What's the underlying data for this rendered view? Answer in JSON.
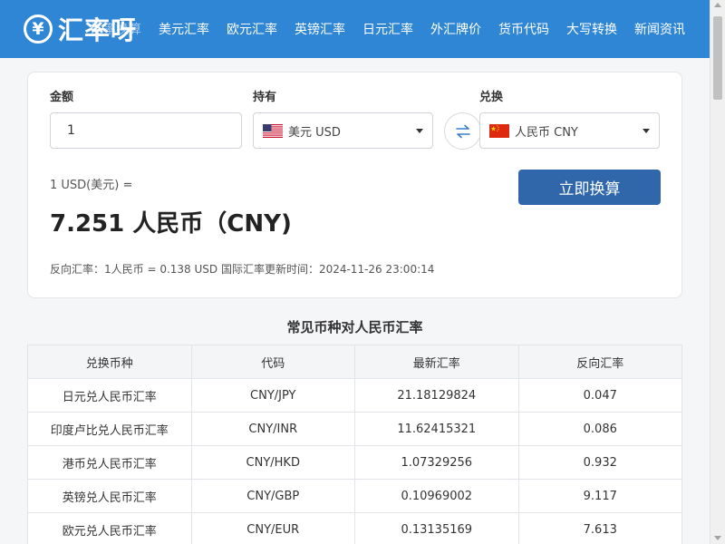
{
  "header": {
    "logo_symbol": "¥",
    "logo_text": "汇率呀",
    "nav": [
      "汇率换算",
      "美元汇率",
      "欧元汇率",
      "英镑汇率",
      "日元汇率",
      "外汇牌价",
      "货币代码",
      "大写转换",
      "新闻资讯"
    ]
  },
  "converter": {
    "amount_label": "金额",
    "amount_value": "1",
    "from_label": "持有",
    "from_currency": "美元 USD",
    "to_label": "兑换",
    "to_currency": "人民币 CNY",
    "convert_label": "立即换算",
    "result_prefix": "1 USD(美元) =",
    "result_value": "7.251 人民币（CNY)",
    "reverse_text": "反向汇率：1人民币 = 0.138 USD  国际汇率更新时间：2024-11-26 23:00:14"
  },
  "table": {
    "title": "常见币种对人民币汇率",
    "headers": [
      "兑换币种",
      "代码",
      "最新汇率",
      "反向汇率"
    ],
    "rows": [
      [
        "日元兑人民币汇率",
        "CNY/JPY",
        "21.18129824",
        "0.047"
      ],
      [
        "印度卢比兑人民币汇率",
        "CNY/INR",
        "11.62415321",
        "0.086"
      ],
      [
        "港币兑人民币汇率",
        "CNY/HKD",
        "1.07329256",
        "0.932"
      ],
      [
        "英镑兑人民币汇率",
        "CNY/GBP",
        "0.10969002",
        "9.117"
      ],
      [
        "欧元兑人民币汇率",
        "CNY/EUR",
        "0.13135169",
        "7.613"
      ]
    ]
  },
  "colors": {
    "header_bg": "#2f86d5",
    "button_bg": "#2f67aa"
  }
}
